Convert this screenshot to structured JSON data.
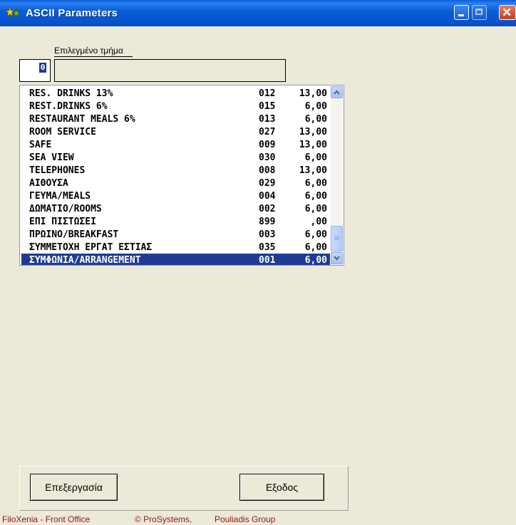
{
  "window": {
    "title": "ASCII Parameters",
    "controls": {
      "minimize_icon": "minimize-icon",
      "maximize_icon": "maximize-icon",
      "close_icon": "close-icon",
      "close_glyph": "✕"
    }
  },
  "selected_section": {
    "label": "Επιλεγμένο τμήμα",
    "code_value": "0",
    "name_value": ""
  },
  "departments": [
    {
      "name": "RES. DRINKS 13%",
      "code": "012",
      "rate": "13,00"
    },
    {
      "name": "REST.DRINKS 6%",
      "code": "015",
      "rate": "6,00"
    },
    {
      "name": "RESTAURANT MEALS 6%",
      "code": "013",
      "rate": "6,00"
    },
    {
      "name": "ROOM SERVICE",
      "code": "027",
      "rate": "13,00"
    },
    {
      "name": "SAFE",
      "code": "009",
      "rate": "13,00"
    },
    {
      "name": "SEA VIEW",
      "code": "030",
      "rate": "6,00"
    },
    {
      "name": "TELEPHONES",
      "code": "008",
      "rate": "13,00"
    },
    {
      "name": "ΑΙΘΟΥΣΑ",
      "code": "029",
      "rate": "6,00"
    },
    {
      "name": "ΓΕΥΜΑ/MEALS",
      "code": "004",
      "rate": "6,00"
    },
    {
      "name": "ΔΩΜΑΤΙΟ/ROOMS",
      "code": "002",
      "rate": "6,00"
    },
    {
      "name": "ΕΠΙ ΠΙΣΤΩΣΕΙ",
      "code": "899",
      "rate": ",00"
    },
    {
      "name": "ΠΡΩΙΝΟ/BREAKFAST",
      "code": "003",
      "rate": "6,00"
    },
    {
      "name": "ΣΥΜΜΕΤΟΧΗ ΕΡΓΑΤ ΕΣΤΙΑΣ",
      "code": "035",
      "rate": "6,00"
    },
    {
      "name": "ΣΥΜΦΩΝΙΑ/ARRANGEMENT",
      "code": "001",
      "rate": "6,00",
      "selected": true
    }
  ],
  "buttons": {
    "edit_label": "Επεξεργασία",
    "exit_label": "Εξοδος"
  },
  "footer": {
    "product": "FiloXenia - Front Office",
    "copyright": "© ProSystems,",
    "company": "Pouliadis Group"
  },
  "colors": {
    "titlebar": "#0a5fd8",
    "selection": "#1f3b93",
    "window_bg": "#ece9d8",
    "footer_text": "#8b1a1a"
  }
}
